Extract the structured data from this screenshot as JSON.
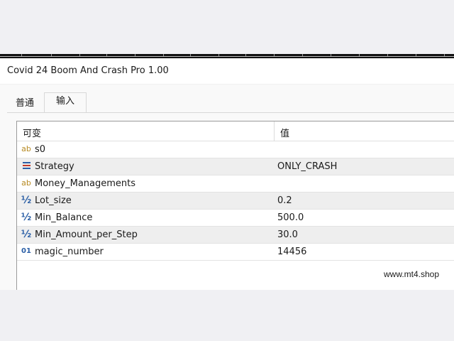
{
  "window": {
    "title": "Covid 24 Boom And Crash Pro 1.00"
  },
  "tabs": [
    {
      "label": "普通",
      "active": false
    },
    {
      "label": "输入",
      "active": true
    }
  ],
  "grid": {
    "headers": {
      "variable": "可变",
      "value": "值"
    },
    "rows": [
      {
        "icon": "string-icon",
        "icon_text": "ab",
        "name": "s0",
        "value": ""
      },
      {
        "icon": "enum-icon",
        "icon_text": "",
        "name": "Strategy",
        "value": "ONLY_CRASH"
      },
      {
        "icon": "string-icon",
        "icon_text": "ab",
        "name": "Money_Managements",
        "value": ""
      },
      {
        "icon": "double-icon",
        "icon_text": "½",
        "name": "Lot_size",
        "value": "0.2"
      },
      {
        "icon": "double-icon",
        "icon_text": "½",
        "name": "Min_Balance",
        "value": "500.0"
      },
      {
        "icon": "double-icon",
        "icon_text": "½",
        "name": "Min_Amount_per_Step",
        "value": "30.0"
      },
      {
        "icon": "integer-icon",
        "icon_text": "01",
        "name": "magic_number",
        "value": "14456"
      }
    ]
  },
  "watermark": "www.mt4.shop",
  "colors": {
    "string_icon": "#b78a22",
    "numeric_icon": "#2b5fa6",
    "enum_icon_stripes": [
      "#2b5fa6",
      "#c0392b",
      "#2b5fa6"
    ],
    "alt_row": "#eeeeee"
  }
}
